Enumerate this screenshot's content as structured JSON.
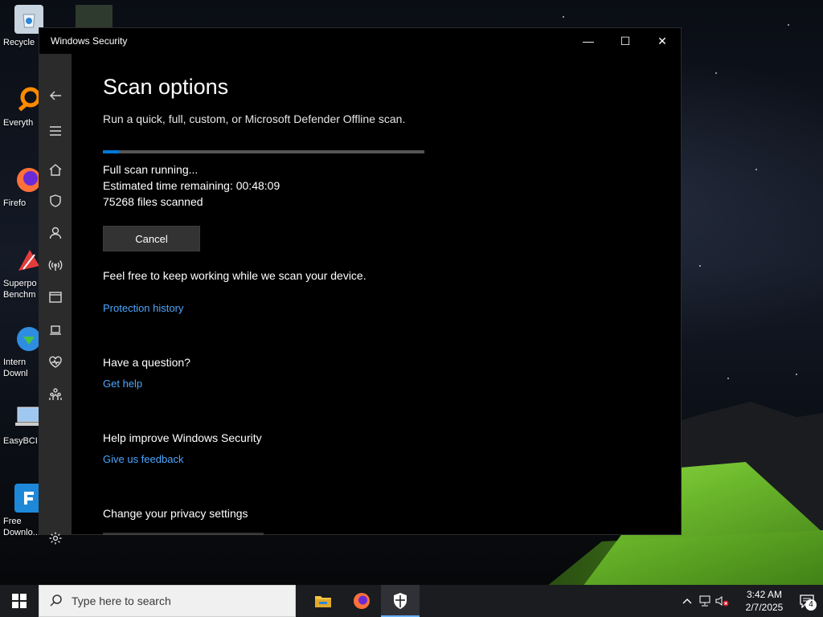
{
  "window": {
    "title": "Windows Security",
    "controls": {
      "minimize": "—",
      "maximize": "☐",
      "close": "✕"
    }
  },
  "page": {
    "heading": "Scan options",
    "subtitle": "Run a quick, full, custom, or Microsoft Defender Offline scan.",
    "progress_fraction": 0.05,
    "accent_color": "#0078d7",
    "status_line_1": "Full scan running...",
    "status_line_2": "Estimated time remaining:  00:48:09",
    "status_line_3": "75268  files scanned",
    "cancel_label": "Cancel",
    "keep_working": "Feel free to keep working while we scan your device.",
    "protection_history_link": "Protection history",
    "question_heading": "Have a question?",
    "get_help_link": "Get help",
    "improve_heading": "Help improve Windows Security",
    "feedback_link": "Give us feedback",
    "privacy_heading": "Change your privacy settings"
  },
  "nav": {
    "items": [
      "back-arrow-icon",
      "hamburger-menu-icon",
      "home-icon",
      "shield-icon",
      "person-icon",
      "wireless-antenna-icon",
      "app-browser-icon",
      "laptop-icon",
      "heart-health-icon",
      "family-icon",
      "gear-icon"
    ]
  },
  "desktop_icons": [
    {
      "label": "Recycle",
      "icon": "recycle-bin-icon"
    },
    {
      "label": "Everyth",
      "icon": "everything-search-icon"
    },
    {
      "label": "Firefo",
      "icon": "firefox-icon"
    },
    {
      "label": "Superpo\nBenchm",
      "icon": "superposition-benchmark-icon"
    },
    {
      "label": "Intern\nDownl",
      "icon": "internet-download-manager-icon"
    },
    {
      "label": "EasyBCI",
      "icon": "easybcd-icon"
    },
    {
      "label": "Free\nDownlo...",
      "icon": "free-download-manager-icon"
    }
  ],
  "taskbar": {
    "search_placeholder": "Type here to search",
    "apps": [
      "file-explorer-icon",
      "firefox-icon",
      "windows-security-icon"
    ],
    "time": "3:42 AM",
    "date": "2/7/2025",
    "notification_count": "4"
  }
}
